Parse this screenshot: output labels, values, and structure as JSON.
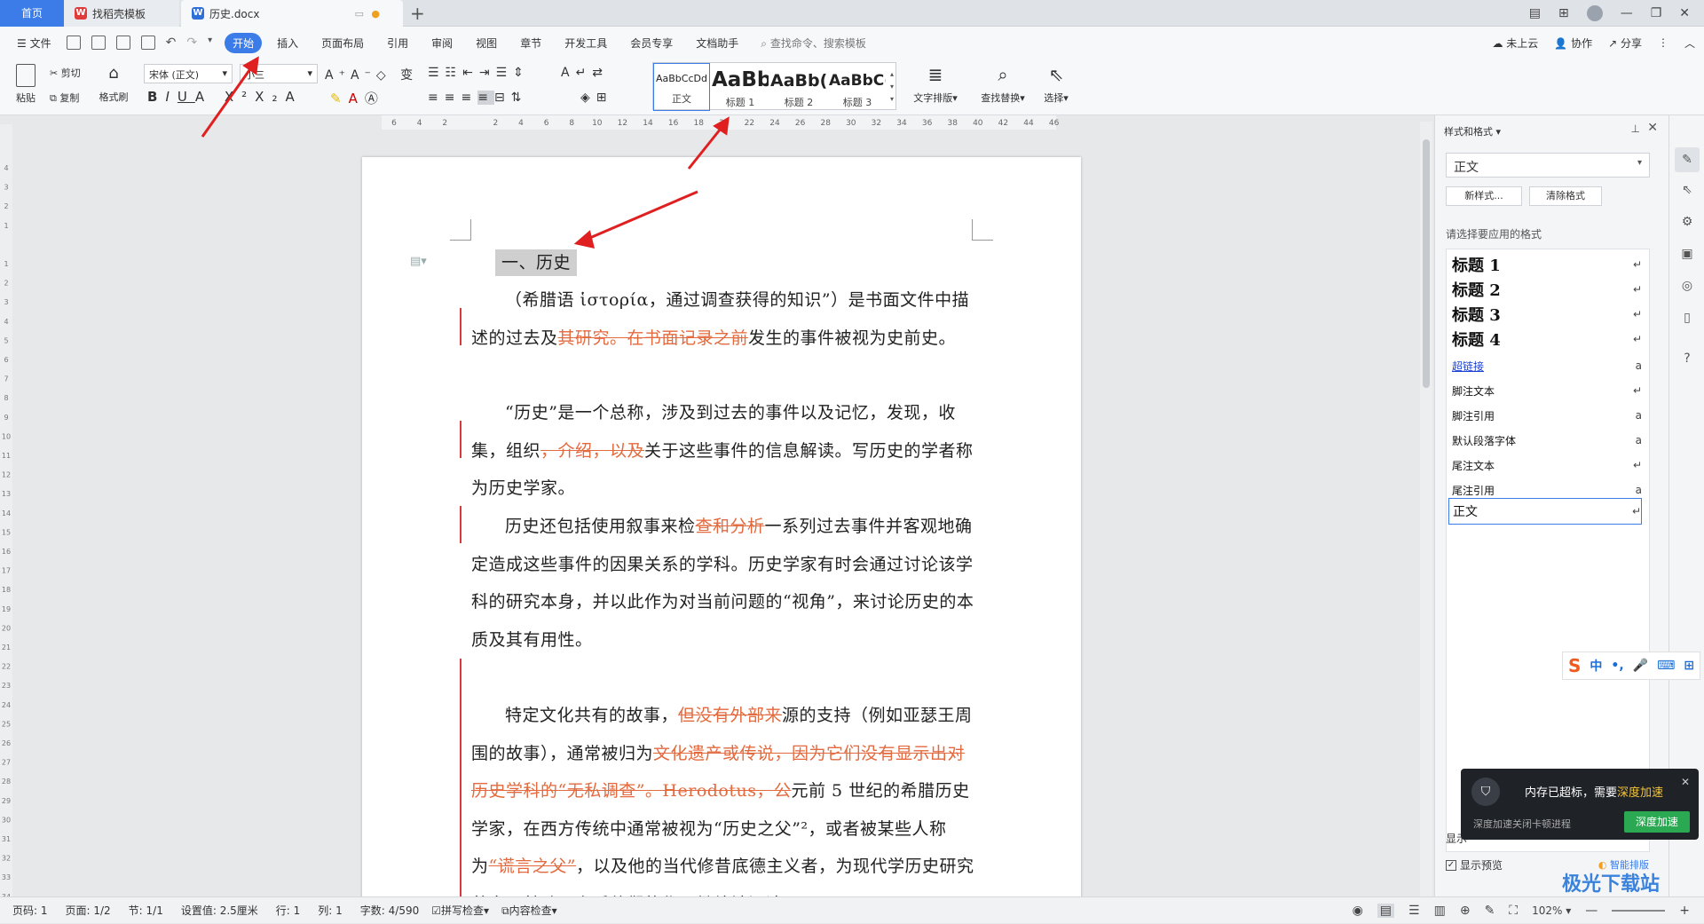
{
  "tabs": {
    "home": "首页",
    "templates": "找稻壳模板",
    "document": "历史.docx"
  },
  "menu": {
    "file": "文件",
    "items": [
      "开始",
      "插入",
      "页面布局",
      "引用",
      "审阅",
      "视图",
      "章节",
      "开发工具",
      "会员专享",
      "文档助手"
    ],
    "search": "查找命令、搜索模板",
    "right": [
      "未上云",
      "协作",
      "分享"
    ]
  },
  "ribbon": {
    "paste": "粘贴",
    "cut": "剪切",
    "copy": "复制",
    "format_painter": "格式刷",
    "font_name": "宋体 (正文)",
    "font_size": "小三",
    "styles": [
      {
        "sample": "AaBbCcDd",
        "label": "正文"
      },
      {
        "sample": "AaBb",
        "label": "标题 1"
      },
      {
        "sample": "AaBb(",
        "label": "标题 2"
      },
      {
        "sample": "AaBbC(",
        "label": "标题 3"
      }
    ],
    "text_layout": "文字排版",
    "find_replace": "查找替换",
    "select": "选择"
  },
  "ruler_ticks": [
    "6",
    "4",
    "2",
    "",
    "2",
    "4",
    "6",
    "8",
    "10",
    "12",
    "14",
    "16",
    "18",
    "20",
    "22",
    "24",
    "26",
    "28",
    "30",
    "32",
    "34",
    "36",
    "38",
    "40",
    "42",
    "44",
    "46"
  ],
  "vruler_ticks": [
    "4",
    "3",
    "2",
    "1",
    "",
    "1",
    "2",
    "3",
    "4",
    "5",
    "6",
    "7",
    "8",
    "9",
    "10",
    "11",
    "12",
    "13",
    "14",
    "15",
    "16",
    "17",
    "18",
    "19",
    "20",
    "21",
    "22",
    "23",
    "24",
    "25",
    "26",
    "27",
    "28",
    "29",
    "30",
    "31",
    "32",
    "33",
    "34"
  ],
  "document": {
    "heading": "一、历史",
    "p1": [
      {
        "t": "（希腊语 ἱστορία，通过调查获得的知识”）是书面文件中描述的过去及",
        "d": false
      },
      {
        "t": "其研究。在书面记录之前",
        "d": true
      },
      {
        "t": "发生的事件被视为史前史。",
        "d": false
      }
    ],
    "p2": [
      {
        "t": "“历史”是一个总称，涉及到过去的事件以及记忆，发现，收集，组织",
        "d": false
      },
      {
        "t": "，介绍，以及",
        "d": true
      },
      {
        "t": "关于这些事件的信息解读。写历史的学者称为历史学家。",
        "d": false
      }
    ],
    "p3": [
      {
        "t": "历史还包括使用叙事来检",
        "d": false
      },
      {
        "t": "查和分析",
        "d": true
      },
      {
        "t": "一系列过去事件并客观地确定造成这些事件的因果关系的学科。历史学家有时会通过讨论该学科的研究本身，并以此作为对当前问题的“视角”，来讨论历史的本质及其有用性。",
        "d": false
      }
    ],
    "p4": [
      {
        "t": "特定文化共有的故事，",
        "d": false
      },
      {
        "t": "但没有外部来",
        "d": true
      },
      {
        "t": "源的支持（例如亚瑟王周围的故事），通常被归为",
        "d": false
      },
      {
        "t": "文化遗产或传说，因为它们没有显示出对历史学科的“无私调查”。Herodotus，公",
        "d": true
      },
      {
        "t": "元前 5 世纪的希腊历史学家，在西方传统中通常被视为“历史之父”²，或者被某些人称为",
        "d": false
      },
      {
        "t": "“谎言之父”",
        "d": true
      },
      {
        "t": "，以及他的当代修昔底德主义者，为现代学历史研究奠定了基础，之后他们的作品继续被阅读。",
        "d": false
      }
    ]
  },
  "panel": {
    "title": "样式和格式",
    "current": "正文",
    "new_style": "新样式...",
    "clear_format": "清除格式",
    "choose": "请选择要应用的格式",
    "styles": [
      {
        "name": "标题 1",
        "type": "h",
        "mark": "↵"
      },
      {
        "name": "标题 2",
        "type": "h",
        "mark": "↵"
      },
      {
        "name": "标题 3",
        "type": "h",
        "mark": "↵"
      },
      {
        "name": "标题 4",
        "type": "h",
        "mark": "↵"
      },
      {
        "name": "超链接",
        "type": "link",
        "mark": "a"
      },
      {
        "name": "脚注文本",
        "type": "s",
        "mark": "↵"
      },
      {
        "name": "脚注引用",
        "type": "s",
        "mark": "a"
      },
      {
        "name": "默认段落字体",
        "type": "s",
        "mark": "a"
      },
      {
        "name": "尾注文本",
        "type": "s",
        "mark": "↵"
      },
      {
        "name": "尾注引用",
        "type": "s",
        "mark": "a"
      },
      {
        "name": "正文",
        "type": "sel",
        "mark": "↵"
      }
    ],
    "show_label": "显示",
    "show_preview": "显示预览",
    "smart_layout": "智能排版"
  },
  "popup": {
    "text1": "内存已超标，需要",
    "text2": "深度加速",
    "sub": "深度加速关闭卡顿进程",
    "button": "深度加速"
  },
  "status": {
    "page_code": "页码: 1",
    "page": "页面: 1/2",
    "section": "节: 1/1",
    "setting": "设置值: 2.5厘米",
    "row": "行: 1",
    "col": "列: 1",
    "words": "字数: 4/590",
    "spell": "拼写检查",
    "content": "内容检查",
    "zoom": "102%"
  },
  "ime": {
    "lang": "中"
  },
  "watermark": "极光下载站",
  "colors": {
    "accent": "#3b7ce8",
    "deleted": "#e36a3e",
    "revision_bar": "#d63a3a",
    "arrow": "#e02020"
  }
}
